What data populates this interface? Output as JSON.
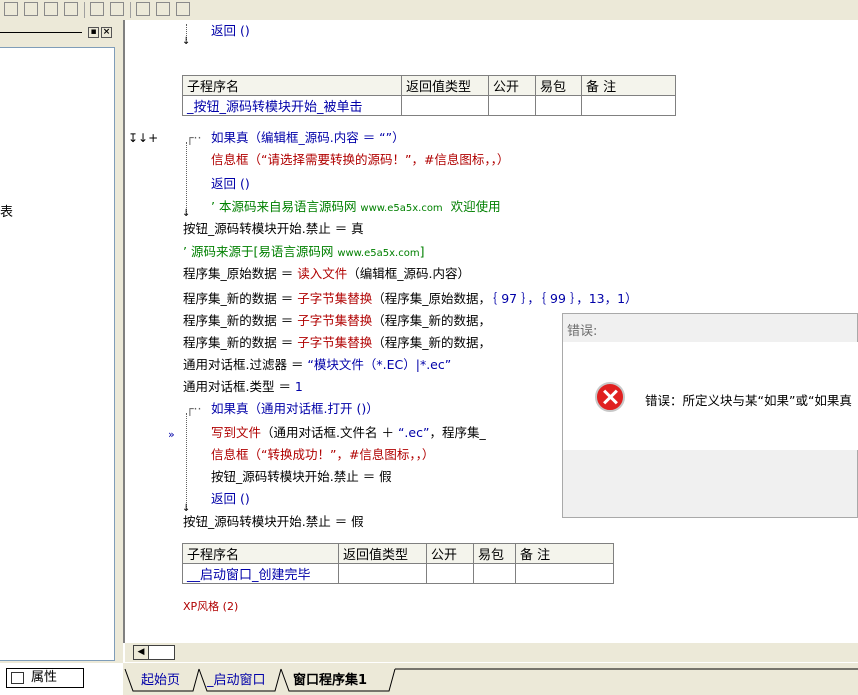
{
  "left_panel": {
    "partial_text": "表",
    "properties_tab": "属性"
  },
  "top_code": {
    "return_line": "返回 ()"
  },
  "table1": {
    "headers": [
      "子程序名",
      "返回值类型",
      "公开",
      "易包",
      "备 注"
    ],
    "name": "_按钮_源码转模块开始_被单击"
  },
  "code_lines": {
    "l1_if": "如果真（编辑框_源码.内容 ＝ “”）",
    "l2_msg": "信息框（“请选择需要转换的源码！”，#信息图标，，）",
    "l3_ret": "返回 ()",
    "l4_comment_a": "’ 本源码来自易语言源码网 ",
    "l4_comment_url": "www.e5a5x.com",
    "l4_comment_b": "  欢迎使用",
    "l5": "按钮_源码转模块开始.禁止 ＝ 真",
    "l6_a": "’ 源码来源于[易语言源码网 ",
    "l6_url": "www.e5a5x.com",
    "l6_b": "]",
    "l7_a": "程序集_原始数据 ＝ ",
    "l7_fn": "读入文件",
    "l7_b": "（编辑框_源码.内容）",
    "l8_a": "程序集_新的数据 ＝ ",
    "l8_fn": "子字节集替换",
    "l8_b": "（程序集_原始数据，",
    "l8_c": "｛ 97 ｝，｛ 99 ｝，13，1）",
    "l9_a": "程序集_新的数据 ＝ ",
    "l9_fn": "子字节集替换",
    "l9_b": "（程序集_新的数据，",
    "l10_a": "程序集_新的数据 ＝ ",
    "l10_fn": "子字节集替换",
    "l10_b": "（程序集_新的数据，",
    "l11_a": "通用对话框.过滤器 ＝ ",
    "l11_b": "“模块文件（*.EC）|*.ec”",
    "l12_a": "通用对话框.类型 ＝ ",
    "l12_b": "1",
    "l13": "如果真（通用对话框.打开 ()）",
    "l14_fn": "写到文件",
    "l14_b": "（通用对话框.文件名 ＋ ",
    "l14_c": "“.ec”",
    "l14_d": "，程序集_",
    "l15": "信息框（“转换成功！”，#信息图标，，）",
    "l16": "按钮_源码转模块开始.禁止 ＝ 假",
    "l17": "返回 ()",
    "l18": "按钮_源码转模块开始.禁止 ＝ 假"
  },
  "table2": {
    "headers": [
      "子程序名",
      "返回值类型",
      "公开",
      "易包",
      "备 注"
    ],
    "name": "__启动窗口_创建完毕"
  },
  "xp_line": "XP风格 (2)",
  "gutter": {
    "marker1": "↧↓+",
    "marker2": "»"
  },
  "tabs": [
    "起始页",
    "_启动窗口",
    "窗口程序集1"
  ],
  "dialog": {
    "title": "错误:",
    "message": "错误：所定义块与某“如果”或“如果真"
  }
}
